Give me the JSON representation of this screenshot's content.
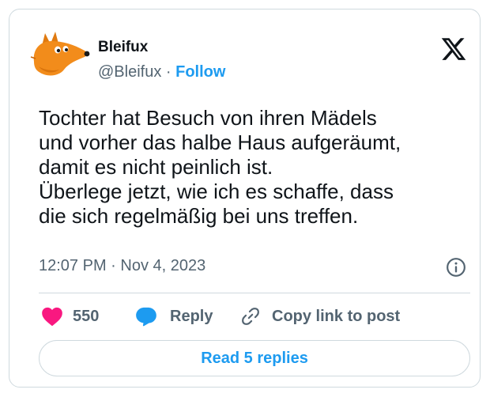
{
  "tweet": {
    "author": {
      "display_name": "Bleifux",
      "handle": "@Bleifux",
      "separator": " · ",
      "follow_label": "Follow"
    },
    "text": "Tochter hat Besuch von ihren Mädels\nund vorher das halbe Haus aufgeräumt,\ndamit es nicht peinlich ist.\nÜberlege jetzt, wie ich es schaffe, dass\ndie sich regelmäßig bei uns treffen.",
    "timestamp": "12:07 PM · Nov 4, 2023",
    "actions": {
      "like_count": "550",
      "reply_label": "Reply",
      "copy_link_label": "Copy link to post"
    },
    "read_replies_label": "Read 5 replies"
  },
  "colors": {
    "accent": "#1d9bf0",
    "like": "#f91880",
    "text_primary": "#0f1419",
    "text_secondary": "#536471",
    "border": "#cfd9de",
    "avatar_fox": "#f28c1b"
  },
  "icons": {
    "brand": "x-logo-icon",
    "info": "info-icon",
    "like": "heart-icon",
    "reply": "speech-bubble-icon",
    "copy": "link-icon"
  }
}
